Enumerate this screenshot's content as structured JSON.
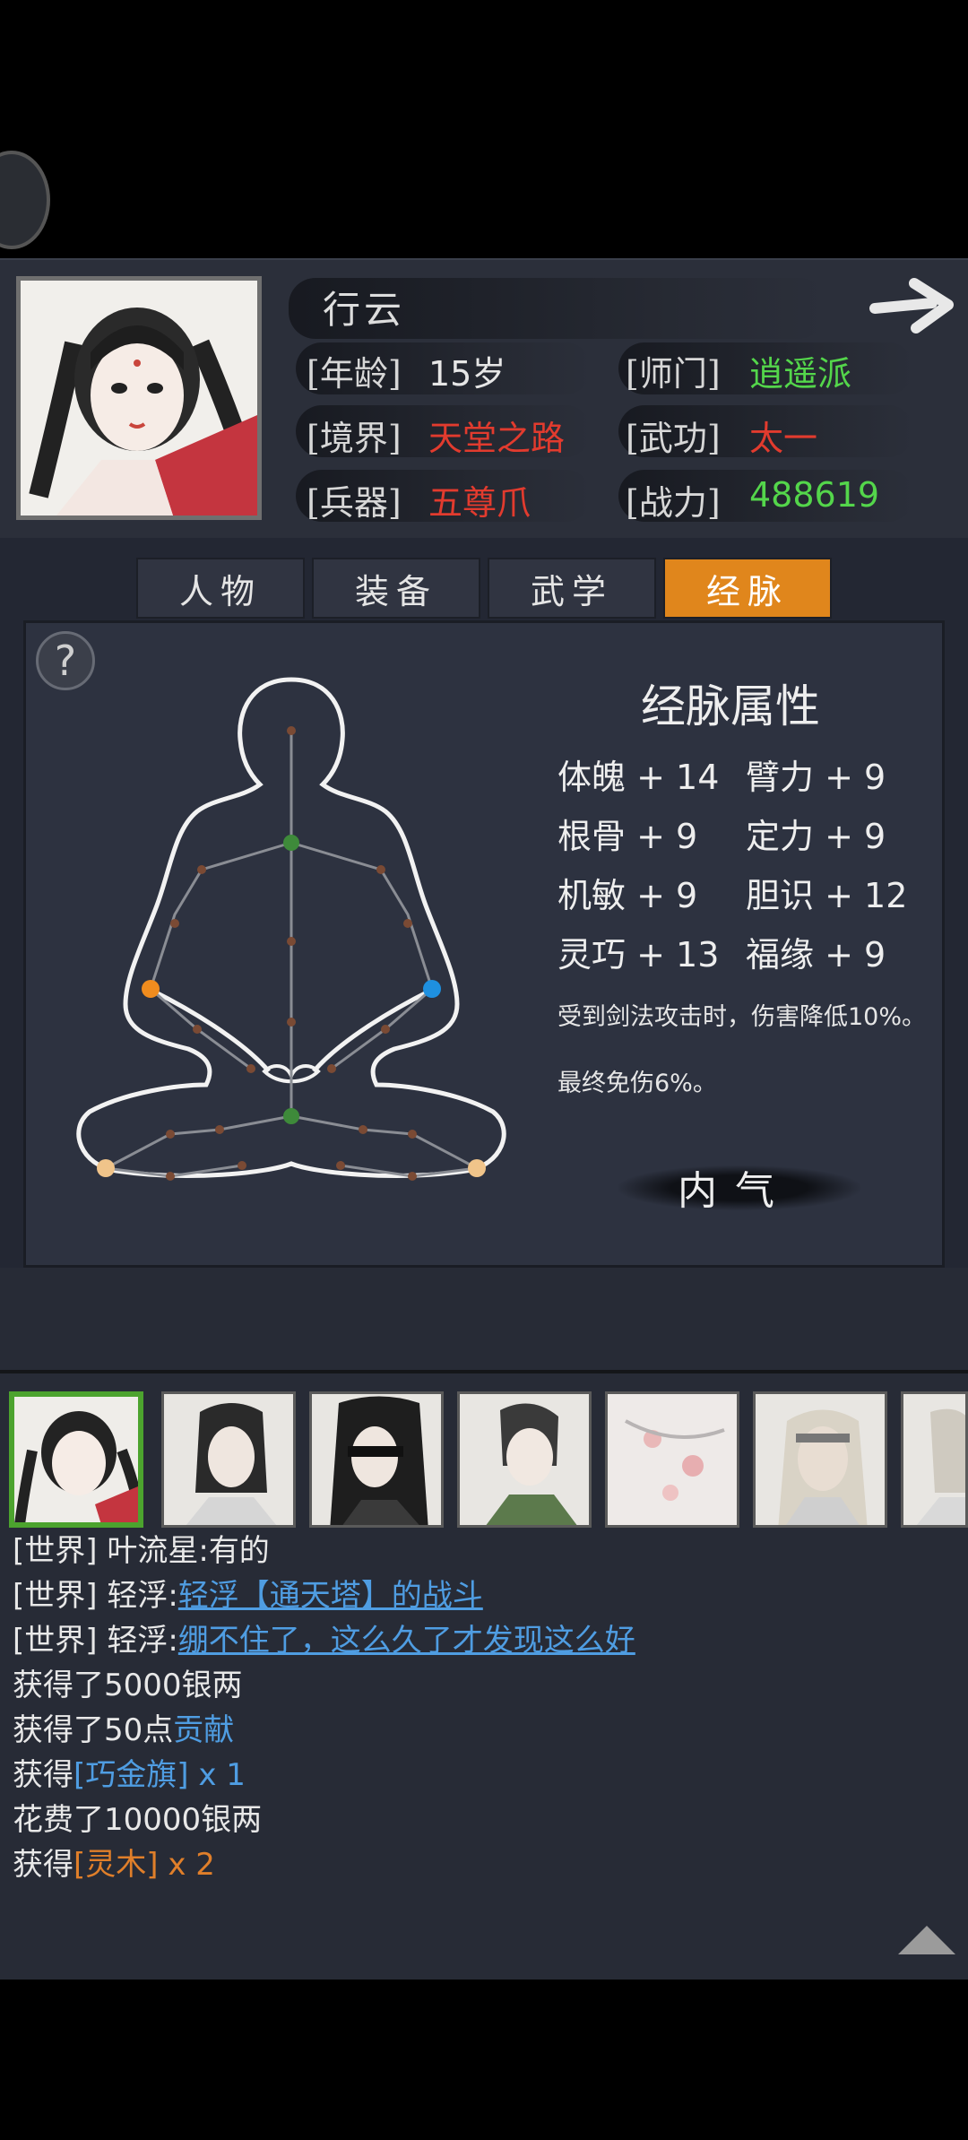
{
  "character": {
    "name": "行云",
    "age_label": "[年龄]",
    "age": "15岁",
    "sect_label": "[师门]",
    "sect": "逍遥派",
    "realm_label": "[境界]",
    "realm": "天堂之路",
    "martial_label": "[武功]",
    "martial": "太一",
    "weapon_label": "[兵器]",
    "weapon": "五尊爪",
    "power_label": "[战力]",
    "power": "488619"
  },
  "tabs": [
    {
      "label": "人物",
      "active": false
    },
    {
      "label": "装备",
      "active": false
    },
    {
      "label": "武学",
      "active": false
    },
    {
      "label": "经脉",
      "active": true
    }
  ],
  "help_label": "?",
  "meridian": {
    "title": "经脉属性",
    "attributes": [
      {
        "name": "体魄",
        "value": "+ 14"
      },
      {
        "name": "臂力",
        "value": "+ 9"
      },
      {
        "name": "根骨",
        "value": "+ 9"
      },
      {
        "name": "定力",
        "value": "+ 9"
      },
      {
        "name": "机敏",
        "value": "+ 9"
      },
      {
        "name": "胆识",
        "value": "+ 12"
      },
      {
        "name": "灵巧",
        "value": "+ 13"
      },
      {
        "name": "福缘",
        "value": "+ 9"
      }
    ],
    "effect_1": "受到剑法攻击时，伤害降低10%。",
    "effect_2": "最终免伤6%。",
    "inner_button": "内气"
  },
  "chat": {
    "lines": [
      {
        "prefix": "[世界]",
        "speaker": "叶流星:",
        "text": "有的"
      },
      {
        "prefix": "[世界]",
        "speaker": "轻浮:",
        "text": "轻浮【通天塔】的战斗"
      },
      {
        "prefix": "[世界]",
        "speaker": "轻浮:",
        "text": "绷不住了，这么久了才发现这么好"
      }
    ],
    "log": {
      "silver_gain": "获得了5000银两",
      "contrib_pre": "获得了50点",
      "contrib_word": "贡献",
      "flag_pre": "获得",
      "flag_item": "[巧金旗]",
      "flag_qty": " x 1",
      "spent": "花费了10000银两",
      "wood_pre": "获得",
      "wood_item": "[灵木]",
      "wood_qty": " x 2"
    }
  },
  "colors": {
    "accent_tab": "#e0861c",
    "value_red": "#e23b2e",
    "value_green": "#54d64b",
    "link_blue": "#4f9de2",
    "item_orange": "#e07f2a"
  }
}
